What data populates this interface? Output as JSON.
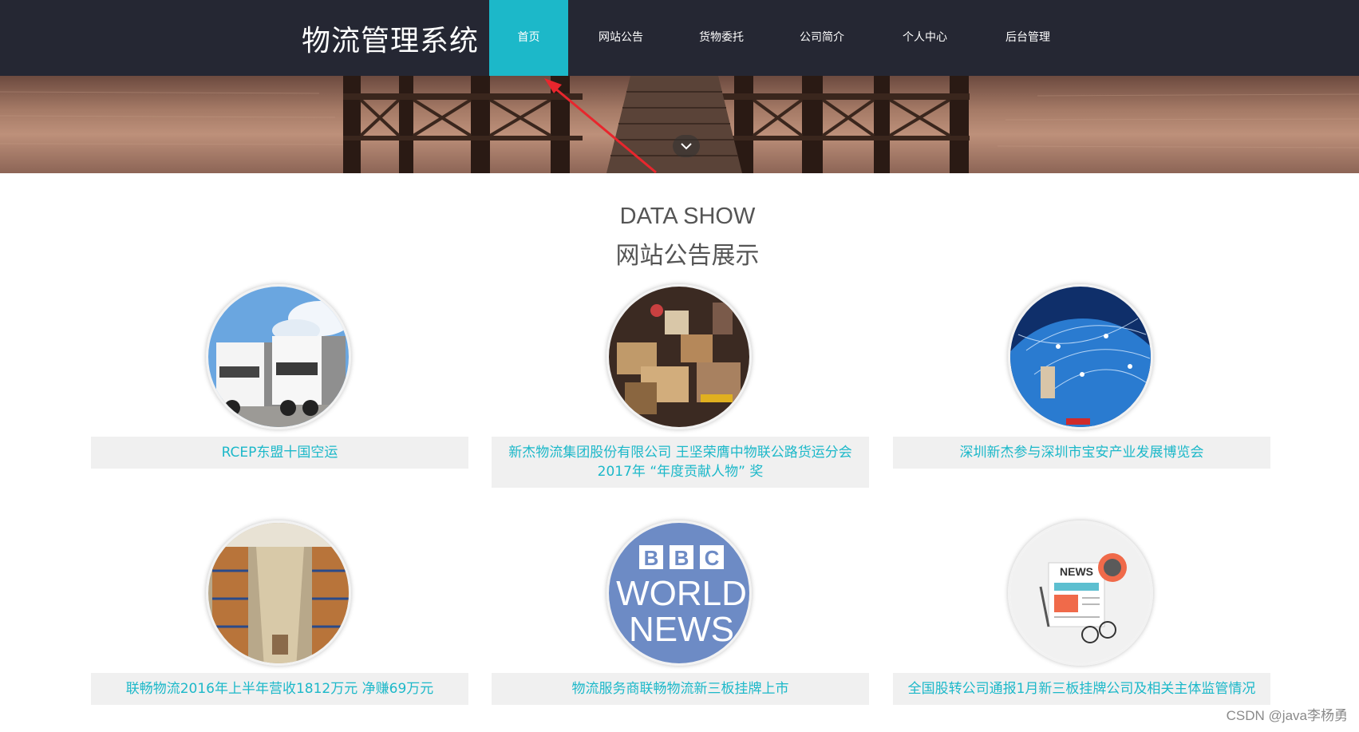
{
  "header": {
    "brand": "物流管理系统",
    "nav": [
      {
        "label": "首页",
        "active": true
      },
      {
        "label": "网站公告",
        "active": false
      },
      {
        "label": "货物委托",
        "active": false
      },
      {
        "label": "公司简介",
        "active": false
      },
      {
        "label": "个人中心",
        "active": false
      },
      {
        "label": "后台管理",
        "active": false
      }
    ]
  },
  "banner": {
    "scroll_icon": "chevron-down-icon"
  },
  "section": {
    "title_en": "DATA SHOW",
    "title_cn": "网站公告展示"
  },
  "announcements": [
    {
      "title": "RCEP东盟十国空运",
      "image": "trucks"
    },
    {
      "title": "新杰物流集团股份有限公司 王坚荣膺中物联公路货运分会 2017年 “年度贡献人物” 奖",
      "image": "parcels"
    },
    {
      "title": "深圳新杰参与深圳市宝安产业发展博览会",
      "image": "globe-network"
    },
    {
      "title": "联畅物流2016年上半年营收1812万元 净赚69万元",
      "image": "warehouse"
    },
    {
      "title": "物流服务商联畅物流新三板挂牌上市",
      "image": "bbc-world-news"
    },
    {
      "title": "全国股转公司通报1月新三板挂牌公司及相关主体监管情况",
      "image": "newspaper"
    }
  ],
  "bbc_logo": {
    "line1": "BBC",
    "line2": "WORLD",
    "line3": "NEWS"
  },
  "newspaper_logo": "NEWS",
  "watermark": "CSDN @java李杨勇",
  "colors": {
    "accent": "#1cb8c9",
    "navbar": "#252733",
    "caption_bg": "#f0f0f0"
  }
}
